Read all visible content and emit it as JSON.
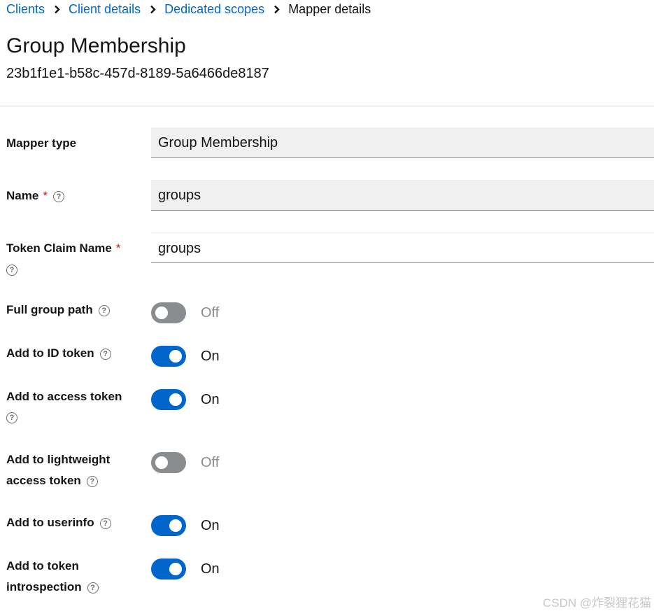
{
  "breadcrumb": {
    "items": [
      "Clients",
      "Client details",
      "Dedicated scopes"
    ],
    "current": "Mapper details"
  },
  "header": {
    "title": "Group Membership",
    "id": "23b1f1e1-b58c-457d-8189-5a6466de8187"
  },
  "form": {
    "mapper_type": {
      "label": "Mapper type",
      "value": "Group Membership"
    },
    "name": {
      "label": "Name",
      "required": "*",
      "value": "groups"
    },
    "token_claim_name": {
      "label": "Token Claim Name",
      "required": "*",
      "value": "groups"
    },
    "toggles": [
      {
        "label": "Full group path",
        "state": "Off",
        "checked": false
      },
      {
        "label": "Add to ID token",
        "state": "On",
        "checked": true
      },
      {
        "label": "Add to access token",
        "state": "On",
        "checked": true
      },
      {
        "label_line1": "Add to lightweight",
        "label_line2": "access token",
        "state": "Off",
        "checked": false
      },
      {
        "label": "Add to userinfo",
        "state": "On",
        "checked": true
      },
      {
        "label_line1": "Add to token",
        "label_line2": "introspection",
        "state": "On",
        "checked": true
      }
    ],
    "help_glyph": "?"
  },
  "watermark": "CSDN @炸裂狸花猫",
  "colors": {
    "link": "#0066cc",
    "toggle_on": "#0066cc",
    "toggle_off": "#8a8d90",
    "required": "#c9190b"
  }
}
